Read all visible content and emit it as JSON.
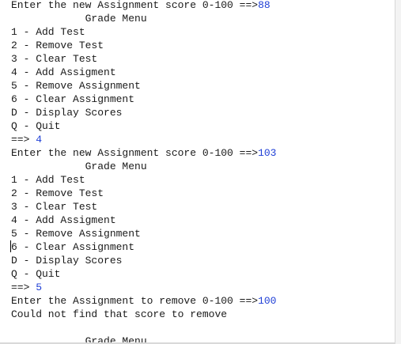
{
  "console": {
    "lines": [
      {
        "text": "Enter the new Assignment score 0-100 ==>",
        "input": "88"
      },
      {
        "text": "            Grade Menu",
        "input": ""
      },
      {
        "text": "1 - Add Test",
        "input": ""
      },
      {
        "text": "2 - Remove Test",
        "input": ""
      },
      {
        "text": "3 - Clear Test",
        "input": ""
      },
      {
        "text": "4 - Add Assigment",
        "input": ""
      },
      {
        "text": "5 - Remove Assignment",
        "input": ""
      },
      {
        "text": "6 - Clear Assignment",
        "input": ""
      },
      {
        "text": "D - Display Scores",
        "input": ""
      },
      {
        "text": "Q - Quit",
        "input": ""
      },
      {
        "text": "==> ",
        "input": "4"
      },
      {
        "text": "Enter the new Assignment score 0-100 ==>",
        "input": "103"
      },
      {
        "text": "            Grade Menu",
        "input": ""
      },
      {
        "text": "1 - Add Test",
        "input": ""
      },
      {
        "text": "2 - Remove Test",
        "input": ""
      },
      {
        "text": "3 - Clear Test",
        "input": ""
      },
      {
        "text": "4 - Add Assigment",
        "input": ""
      },
      {
        "text": "5 - Remove Assignment",
        "input": ""
      },
      {
        "text": "6 - Clear Assignment",
        "input": ""
      },
      {
        "text": "D - Display Scores",
        "input": ""
      },
      {
        "text": "Q - Quit",
        "input": ""
      },
      {
        "text": "==> ",
        "input": "5"
      },
      {
        "text": "Enter the Assignment to remove 0-100 ==>",
        "input": "100"
      },
      {
        "text": "Could not find that score to remove",
        "input": ""
      },
      {
        "text": "",
        "input": ""
      },
      {
        "text": "            Grade Menu",
        "input": ""
      }
    ]
  },
  "colors": {
    "output_text": "#1a1a1a",
    "user_input": "#1f3fd6",
    "background": "#ffffff"
  }
}
